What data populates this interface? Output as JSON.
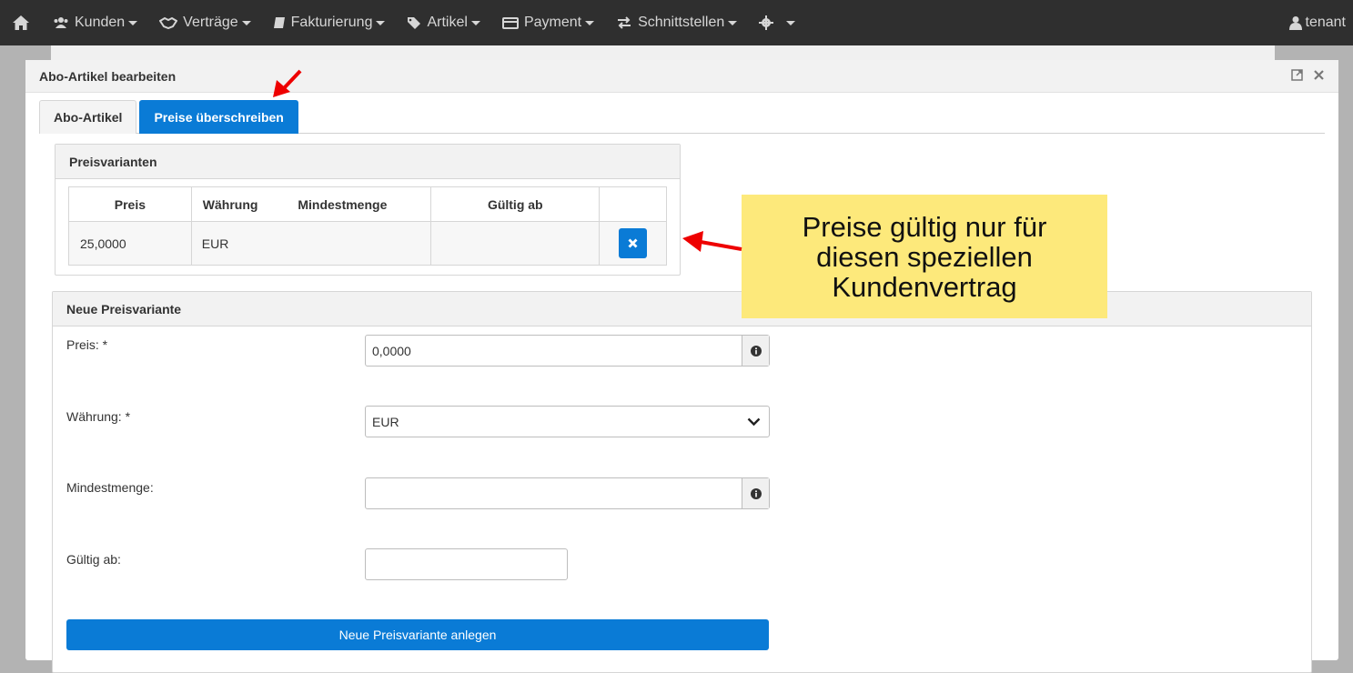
{
  "navbar": {
    "items": [
      {
        "label": "Kunden",
        "icon": "users-icon"
      },
      {
        "label": "Verträge",
        "icon": "handshake-icon"
      },
      {
        "label": "Fakturierung",
        "icon": "book-icon"
      },
      {
        "label": "Artikel",
        "icon": "tag-icon"
      },
      {
        "label": "Payment",
        "icon": "credit-card-icon"
      },
      {
        "label": "Schnittstellen",
        "icon": "exchange-icon"
      }
    ],
    "user": "tenant"
  },
  "modal": {
    "title": "Abo-Artikel bearbeiten",
    "tabs": [
      "Abo-Artikel",
      "Preise überschreiben"
    ],
    "active_tab": "Preise überschreiben"
  },
  "price_variants": {
    "heading": "Preisvarianten",
    "columns": [
      "Preis",
      "Währung",
      "Mindestmenge",
      "Gültig ab"
    ],
    "rows": [
      {
        "preis": "25,0000",
        "waehrung": "EUR",
        "mindestmenge": "",
        "gueltig_ab": ""
      }
    ]
  },
  "new_variant": {
    "heading": "Neue Preisvariante",
    "preis_label": "Preis: *",
    "preis_value": "0,0000",
    "waehrung_label": "Währung: *",
    "waehrung_value": "EUR",
    "mindestmenge_label": "Mindestmenge:",
    "mindestmenge_value": "",
    "gueltig_label": "Gültig ab:",
    "gueltig_value": "",
    "submit_label": "Neue Preisvariante anlegen"
  },
  "annotation": {
    "line1": "Preise gültig nur für",
    "line2": "diesen speziellen",
    "line3": "Kundenvertrag",
    "arrow_color": "#ee0000",
    "callout_color": "#fde97b"
  },
  "colors": {
    "primary": "#0a7bd6",
    "navbar": "#2f2f2f"
  }
}
